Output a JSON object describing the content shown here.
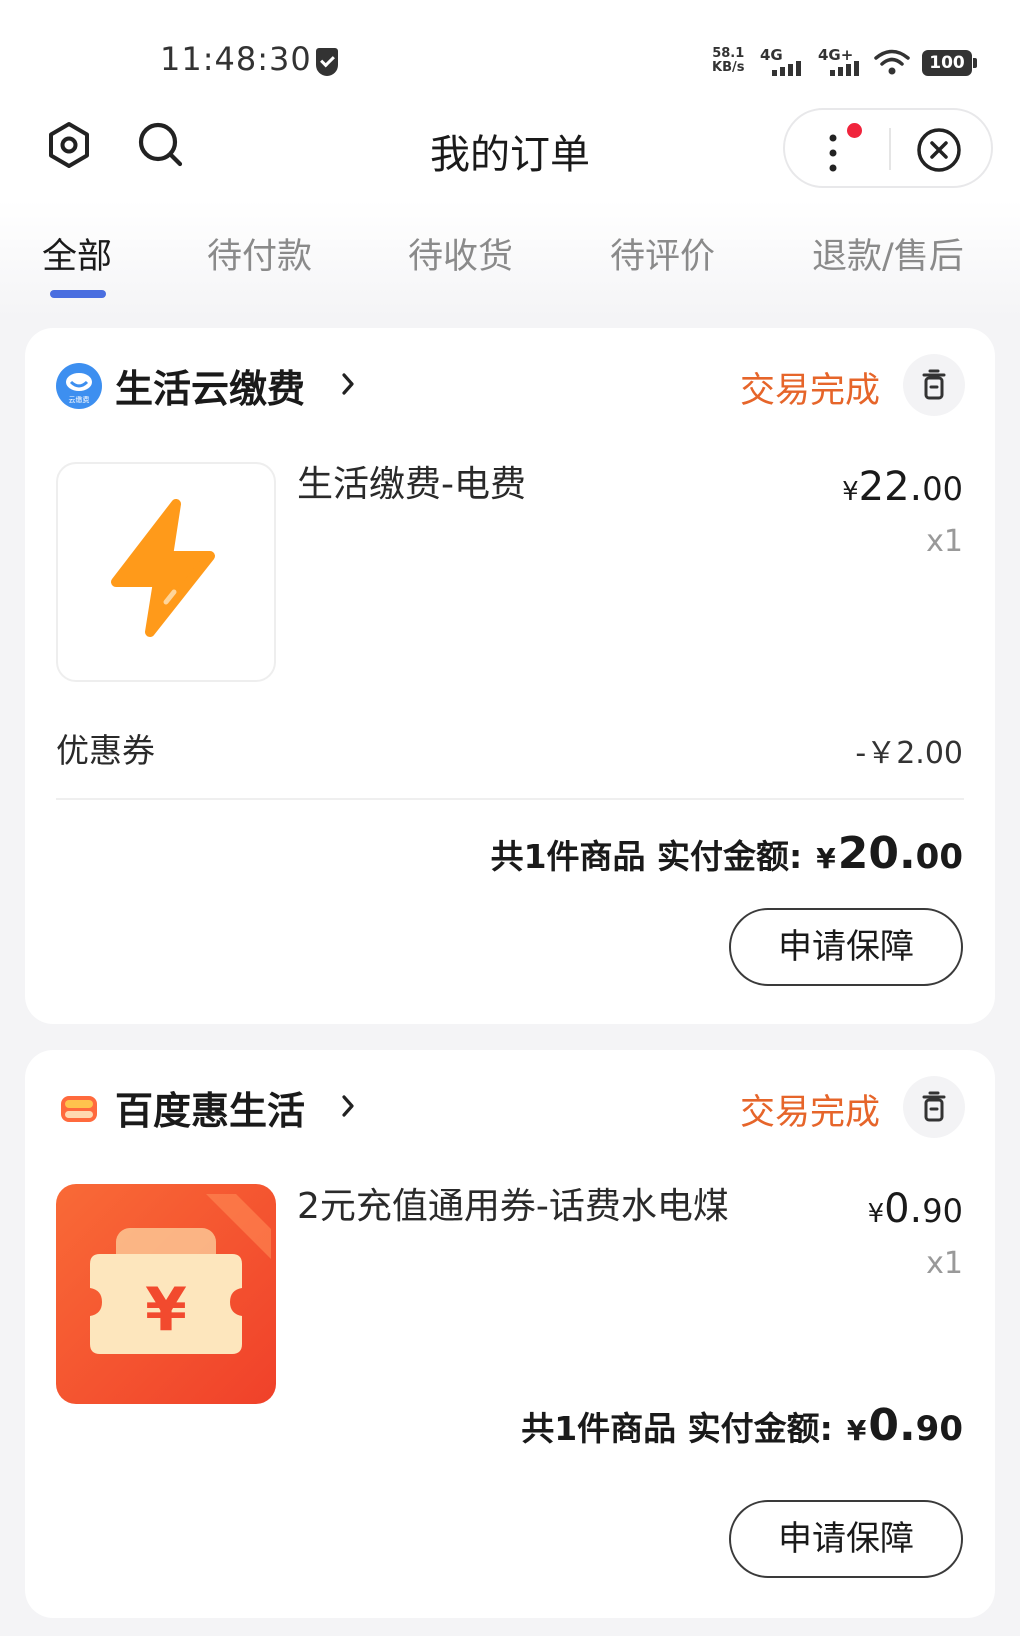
{
  "status_bar": {
    "time": "11:48:30",
    "net_speed_value": "58.1",
    "net_speed_unit": "KB/s",
    "signal_1_label": "4G",
    "signal_2_label": "4G+",
    "battery": "100",
    "icons": [
      "shield-check-icon",
      "signal-icon",
      "wifi-icon",
      "battery-icon"
    ]
  },
  "header": {
    "title": "我的订单",
    "icons": [
      "settings-icon",
      "search-icon",
      "more-icon",
      "close-icon"
    ],
    "notification_dot_color": "#f0243c"
  },
  "tabs": [
    {
      "label": "全部",
      "active": true
    },
    {
      "label": "待付款",
      "active": false
    },
    {
      "label": "待收货",
      "active": false
    },
    {
      "label": "待评价",
      "active": false
    },
    {
      "label": "退款/售后",
      "active": false
    }
  ],
  "colors": {
    "accent": "#4a6ee0",
    "status_orange": "#e6652a",
    "background": "#f4f4f6"
  },
  "orders": [
    {
      "shop_name": "生活云缴费",
      "shop_logo_text": "云缴费",
      "status": "交易完成",
      "product_title": "生活缴费-电费",
      "price_yen": "¥",
      "price_int": "22.",
      "price_dec": "00",
      "quantity": "x1",
      "coupon_label": "优惠券",
      "coupon_value": "-￥2.00",
      "total_label": "共1件商品 实付金额:",
      "total_yen": "¥",
      "total_int": "20.",
      "total_dec": "00",
      "button_label": "申请保障",
      "thumb_icon": "lightning-icon"
    },
    {
      "shop_name": "百度惠生活",
      "status": "交易完成",
      "product_title": "2元充值通用券-话费水电煤",
      "price_yen": "¥",
      "price_int": "0.",
      "price_dec": "90",
      "quantity": "x1",
      "total_label": "共1件商品 实付金额:",
      "total_yen": "¥",
      "total_int": "0.",
      "total_dec": "90",
      "button_label": "申请保障",
      "thumb_icon": "yen-ticket-icon"
    }
  ]
}
